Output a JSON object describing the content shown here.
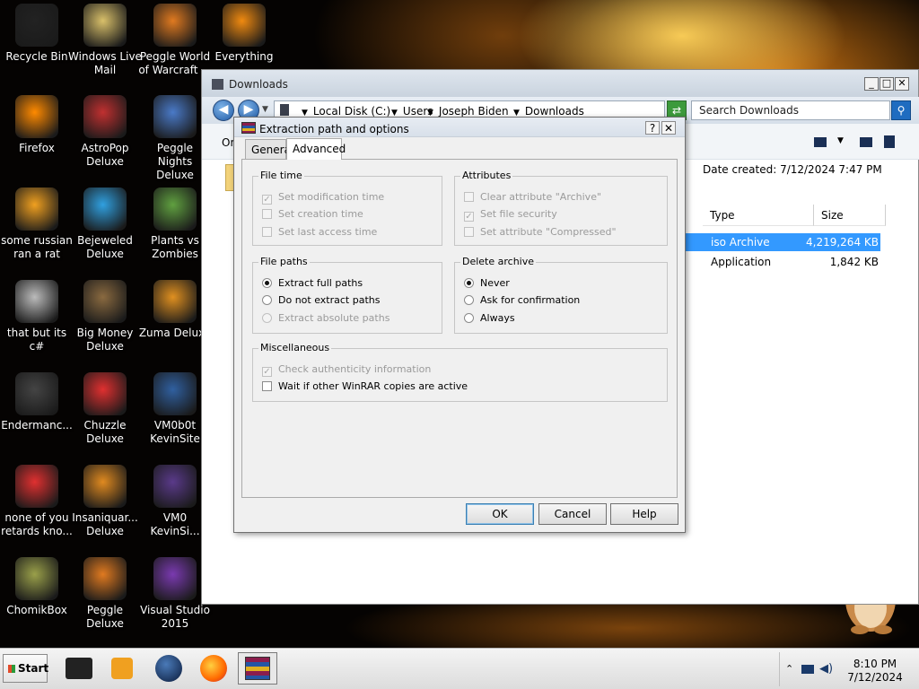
{
  "desktop": {
    "icons": [
      {
        "label": "Recycle Bin",
        "icon": "recycle-bin-icon",
        "color": "#222222"
      },
      {
        "label": "Windows Live Mail",
        "icon": "mail-icon",
        "color": "#d9c06a"
      },
      {
        "label": "Peggle World of Warcraft ...",
        "icon": "peggle-icon",
        "color": "#e07a20"
      },
      {
        "label": "Everything",
        "icon": "everything-icon",
        "color": "#f08a10"
      },
      {
        "label": "Firefox",
        "icon": "firefox-icon",
        "color": "#ff8a00"
      },
      {
        "label": "AstroPop Deluxe",
        "icon": "astropop-icon",
        "color": "#c03030"
      },
      {
        "label": "Peggle Nights Deluxe",
        "icon": "peggle-nights-icon",
        "color": "#4a7ac8"
      },
      {
        "label": "some russian ran a rat",
        "icon": "file-icon",
        "color": "#f0a020"
      },
      {
        "label": "Bejeweled Deluxe",
        "icon": "bejeweled-icon",
        "color": "#30a0e0"
      },
      {
        "label": "Plants vs Zombies",
        "icon": "plants-vs-zombies-icon",
        "color": "#60a040"
      },
      {
        "label": "that but its c#",
        "icon": "shortcut-icon",
        "color": "#bbbbbb"
      },
      {
        "label": "Big Money Deluxe",
        "icon": "big-money-icon",
        "color": "#8a6a40"
      },
      {
        "label": "Zuma Deluxe",
        "icon": "zuma-icon",
        "color": "#e09020"
      },
      {
        "label": "Endermanc...",
        "icon": "app-icon",
        "color": "#444444"
      },
      {
        "label": "Chuzzle Deluxe",
        "icon": "chuzzle-icon",
        "color": "#e03030"
      },
      {
        "label": "VM0b0t KevinSite",
        "icon": "vm-icon",
        "color": "#3060a0"
      },
      {
        "label": "none of you retards kno...",
        "icon": "app-icon",
        "color": "#e03030"
      },
      {
        "label": "Insaniquar... Deluxe",
        "icon": "insaniquarium-icon",
        "color": "#e08a20"
      },
      {
        "label": "VM0 KevinSi...",
        "icon": "vm-icon",
        "color": "#5a3a8a"
      },
      {
        "label": "ChomikBox",
        "icon": "chomikbox-icon",
        "color": "#9aa04a"
      },
      {
        "label": "Peggle Deluxe",
        "icon": "peggle-icon",
        "color": "#e07a20"
      },
      {
        "label": "Visual Studio 2015",
        "icon": "visual-studio-icon",
        "color": "#7a3ab0"
      }
    ]
  },
  "explorer": {
    "title": "Downloads",
    "breadcrumb": [
      "Local Disk (C:)",
      "Users",
      "Joseph Biden",
      "Downloads"
    ],
    "search_placeholder": "Search Downloads",
    "organize_label": "Or",
    "details_text": "Date created: 7/12/2024 7:47 PM",
    "columns": {
      "type": "Type",
      "size": "Size"
    },
    "rows": [
      {
        "type": "iso Archive",
        "size": "4,219,264 KB",
        "selected": true
      },
      {
        "type": "Application",
        "size": "1,842 KB",
        "selected": false
      }
    ]
  },
  "dialog": {
    "title": "Extraction path and options",
    "help_label": "?",
    "close_label": "✕",
    "tabs": [
      "General",
      "Advanced"
    ],
    "file_time": {
      "label": "File time",
      "options": [
        {
          "label": "Set modification time",
          "checked": true
        },
        {
          "label": "Set creation time",
          "checked": false
        },
        {
          "label": "Set last access time",
          "checked": false
        }
      ]
    },
    "attributes": {
      "label": "Attributes",
      "options": [
        {
          "label": "Clear attribute \"Archive\"",
          "checked": false
        },
        {
          "label": "Set file security",
          "checked": true
        },
        {
          "label": "Set attribute \"Compressed\"",
          "checked": false
        }
      ]
    },
    "file_paths": {
      "label": "File paths",
      "options": [
        {
          "label": "Extract full paths",
          "selected": true
        },
        {
          "label": "Do not extract paths",
          "selected": false
        },
        {
          "label": "Extract absolute paths",
          "selected": false
        }
      ]
    },
    "delete_archive": {
      "label": "Delete archive",
      "options": [
        {
          "label": "Never",
          "selected": true
        },
        {
          "label": "Ask for confirmation",
          "selected": false
        },
        {
          "label": "Always",
          "selected": false
        }
      ]
    },
    "misc": {
      "label": "Miscellaneous",
      "options": [
        {
          "label": "Check authenticity information",
          "checked": true
        },
        {
          "label": "Wait if other WinRAR copies are active",
          "checked": false
        }
      ]
    },
    "buttons": {
      "ok": "OK",
      "cancel": "Cancel",
      "help": "Help"
    }
  },
  "taskbar": {
    "start_label": "Start",
    "time": "8:10 PM",
    "date": "7/12/2024"
  }
}
